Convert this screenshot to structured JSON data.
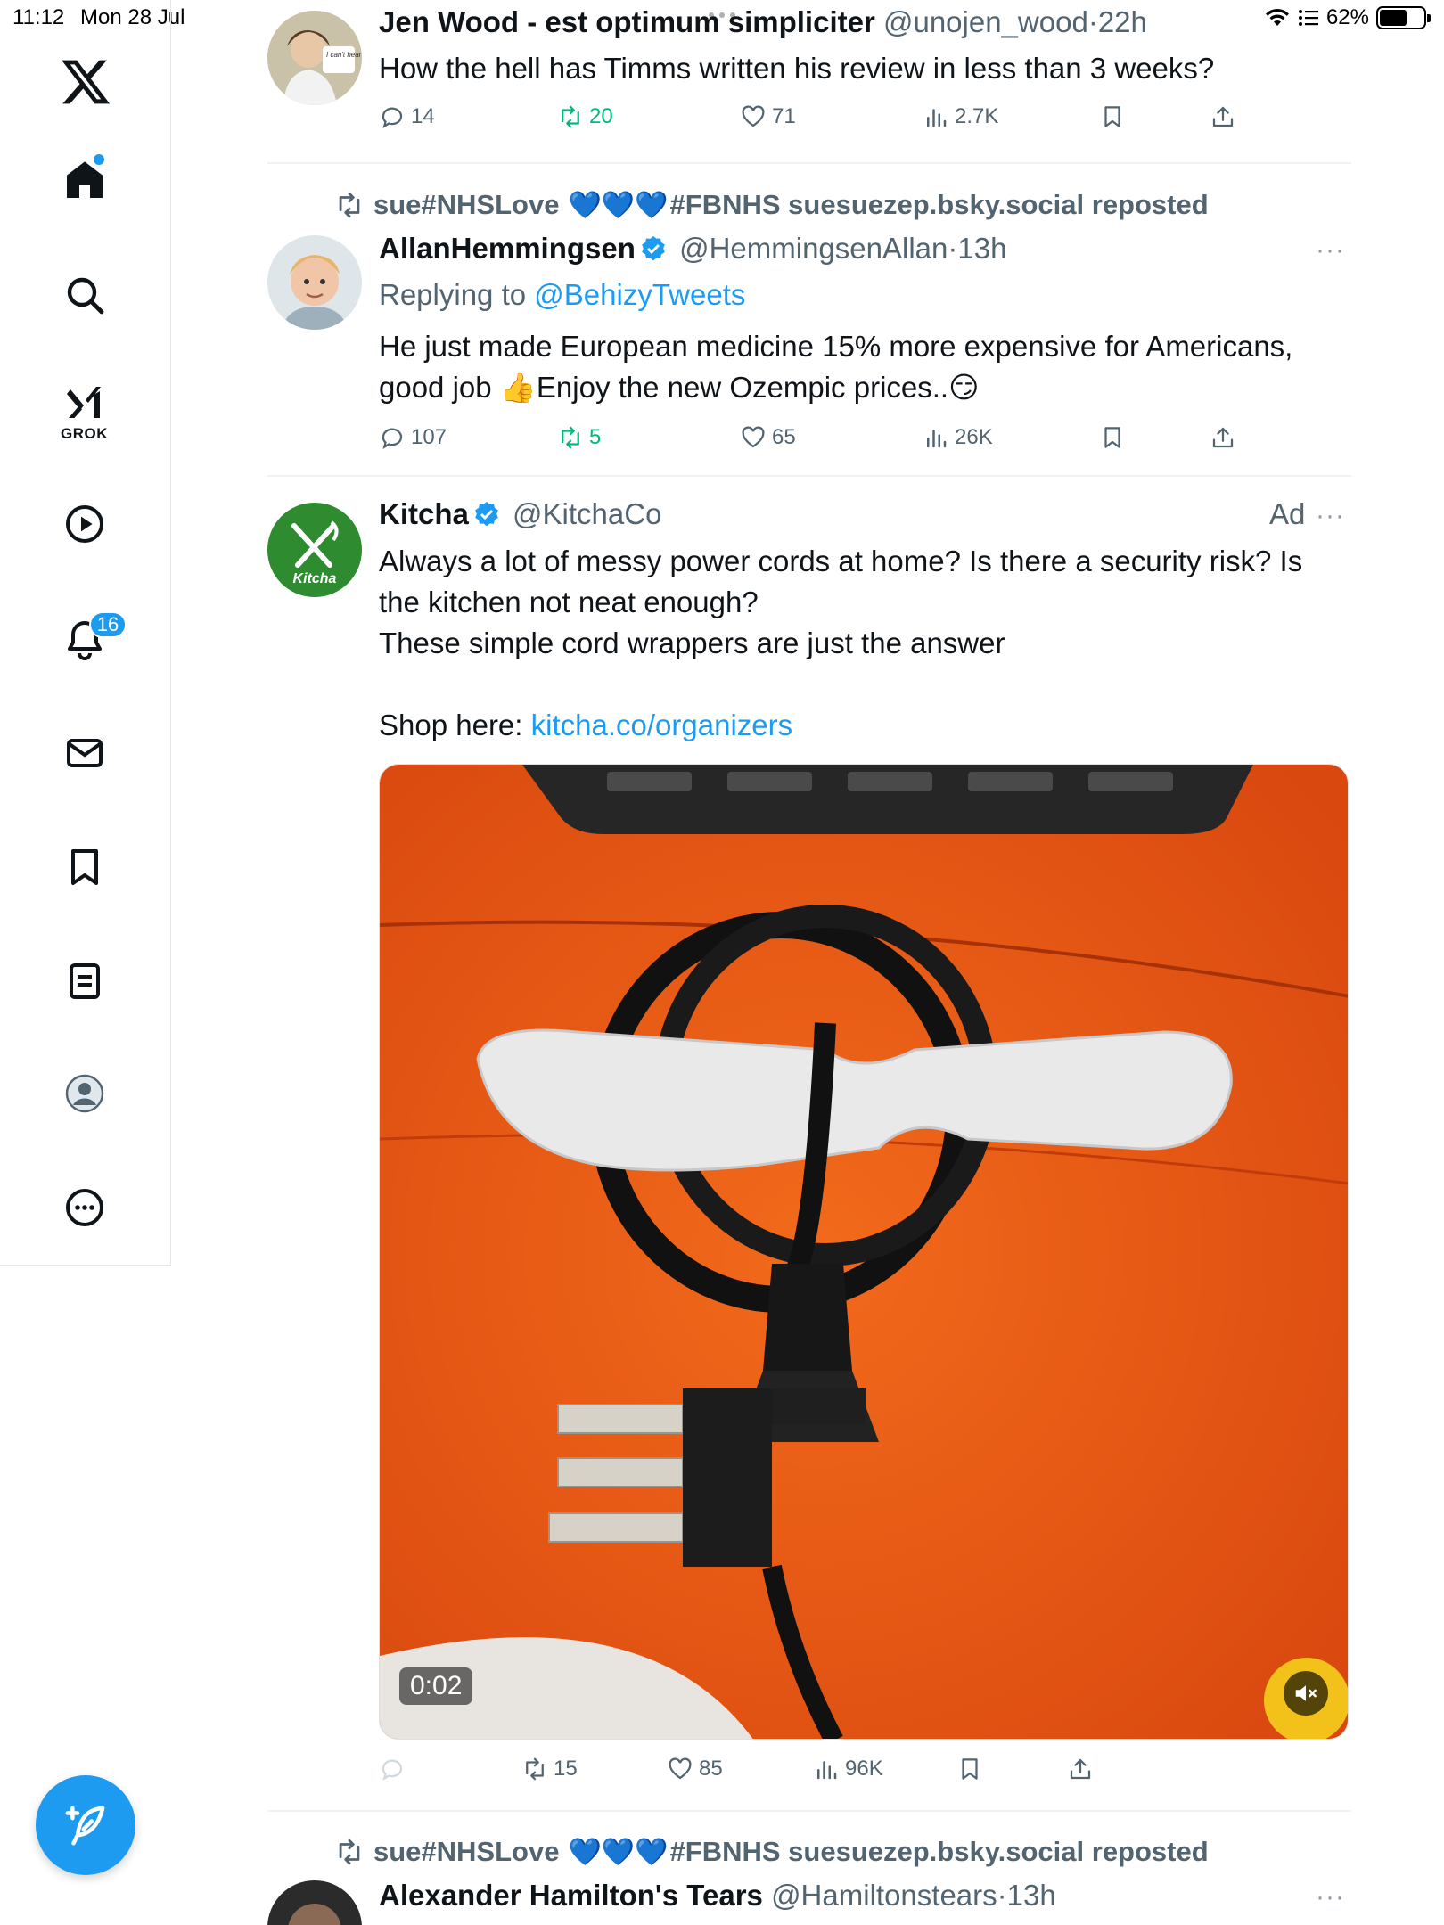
{
  "status_bar": {
    "time": "11:12",
    "date": "Mon 28 Jul",
    "battery": "62%",
    "battery_level": 0.62
  },
  "sidebar": {
    "logo": "x-logo-icon",
    "items": [
      {
        "name": "home",
        "icon": "home-icon",
        "active": true,
        "has_dot": true
      },
      {
        "name": "explore",
        "icon": "search-icon"
      },
      {
        "name": "grok",
        "icon": "grok-icon",
        "label": "GROK"
      },
      {
        "name": "videos",
        "icon": "play-icon"
      },
      {
        "name": "notifications",
        "icon": "bell-icon",
        "badge": "16"
      },
      {
        "name": "messages",
        "icon": "mail-icon"
      },
      {
        "name": "bookmarks",
        "icon": "bookmark-icon"
      },
      {
        "name": "lists",
        "icon": "list-icon"
      },
      {
        "name": "profile",
        "icon": "profile-icon"
      },
      {
        "name": "more",
        "icon": "more-circle-icon"
      }
    ],
    "compose_icon": "compose-feather-icon"
  },
  "colors": {
    "accent": "#1d9bf0",
    "repost_green": "#00ba7c",
    "muted": "#536471"
  },
  "tweets": [
    {
      "name": "Jen Wood - est optimum simpliciter",
      "handle": "@unojen_wood",
      "sep": "·",
      "time": "22h",
      "text": "How the hell has Timms written his review in less than 3 weeks?",
      "avatar_text": "I can't hear applause!",
      "stats": {
        "replies": "14",
        "reposts": "20",
        "likes": "71",
        "views": "2.7K"
      }
    },
    {
      "repost_by_prefix": "sue#NHSLove",
      "repost_by_suffix": "#FBNHS suesuezep.bsky.social reposted",
      "name": "AllanHemmingsen",
      "handle": "@HemmingsenAllan",
      "sep": "·",
      "time": "13h",
      "replying_label": "Replying to",
      "replying_to": "@BehizyTweets",
      "text_line1": "He just made European medicine 15% more expensive for Americans,",
      "text_line2a": "good job ",
      "text_line2b": "Enjoy the new Ozempic prices..",
      "stats": {
        "replies": "107",
        "reposts": "5",
        "likes": "65",
        "views": "26K"
      }
    },
    {
      "name": "Kitcha",
      "handle": "@KitchaCo",
      "ad_label": "Ad",
      "avatar_text": "Kitcha",
      "text_line1": "Always a lot of messy power cords at home? Is there a security risk? Is",
      "text_line2": "the kitchen not neat enough?",
      "text_line3": "These simple cord wrappers are just the answer",
      "shop_label": "Shop here:",
      "shop_link": "kitcha.co/organizers",
      "video_duration": "0:02",
      "stats": {
        "replies": "",
        "reposts": "15",
        "likes": "85",
        "views": "96K"
      }
    },
    {
      "repost_by_prefix": "sue#NHSLove",
      "repost_by_suffix": "#FBNHS suesuezep.bsky.social reposted",
      "name": "Alexander Hamilton's Tears",
      "handle": "@Hamiltonstears",
      "sep": "·",
      "time": "13h"
    }
  ]
}
